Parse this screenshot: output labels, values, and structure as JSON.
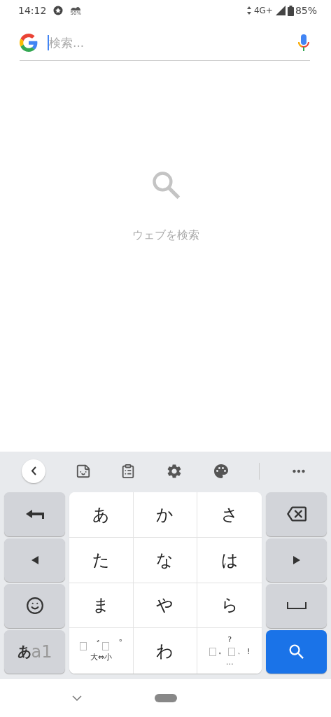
{
  "status_bar": {
    "time": "14:12",
    "weather_reading": "50%",
    "network": "4G+",
    "battery": "85%"
  },
  "search_bar": {
    "placeholder": "検索...",
    "focused": true
  },
  "empty_state": {
    "message": "ウェブを検索"
  },
  "keyboard": {
    "toolbar": [
      {
        "kind": "back"
      },
      {
        "kind": "sticker"
      },
      {
        "kind": "clipboard"
      },
      {
        "kind": "settings"
      },
      {
        "kind": "palette"
      },
      {
        "kind": "divider"
      },
      {
        "kind": "more"
      }
    ],
    "rows": [
      {
        "left": {
          "kind": "undo"
        },
        "keys": [
          {
            "kind": "char",
            "label": "あ"
          },
          {
            "kind": "char",
            "label": "か"
          },
          {
            "kind": "char",
            "label": "さ"
          }
        ],
        "right": {
          "kind": "backspace"
        }
      },
      {
        "left": {
          "kind": "cursor-left"
        },
        "keys": [
          {
            "kind": "char",
            "label": "た"
          },
          {
            "kind": "char",
            "label": "な"
          },
          {
            "kind": "char",
            "label": "は"
          }
        ],
        "right": {
          "kind": "cursor-right"
        }
      },
      {
        "left": {
          "kind": "emoji"
        },
        "keys": [
          {
            "kind": "char",
            "label": "ま"
          },
          {
            "kind": "char",
            "label": "や"
          },
          {
            "kind": "char",
            "label": "ら"
          }
        ],
        "right": {
          "kind": "space"
        }
      },
      {
        "left": {
          "kind": "mode",
          "labels": [
            "あ",
            "a1"
          ]
        },
        "keys": [
          {
            "kind": "modifier",
            "marks": [
              "゛",
              "゜"
            ],
            "caption": "大⇔小"
          },
          {
            "kind": "char",
            "label": "わ"
          },
          {
            "kind": "punctuation",
            "top": "?",
            "marks": [
              "。",
              "、",
              "!"
            ],
            "bottom": "…"
          }
        ],
        "right": {
          "kind": "search"
        }
      }
    ]
  }
}
